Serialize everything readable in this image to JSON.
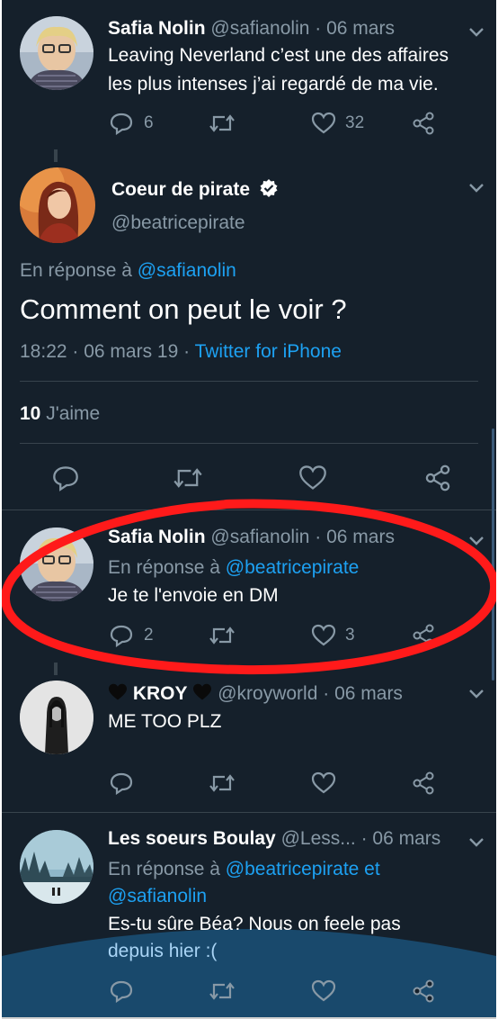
{
  "tweets": [
    {
      "author": "Safia Nolin",
      "handle": "@safianolin",
      "date": "· 06 mars",
      "text_lines": [
        "Leaving Neverland c’est une des affaires",
        "les plus intenses j’ai regardé de ma vie."
      ],
      "replies": "6",
      "likes": "32"
    },
    {
      "author": "Coeur de pirate",
      "handle": "@beatricepirate",
      "reply_prefix": "En réponse à",
      "reply_to": "@safianolin",
      "text": "Comment on peut le voir ?",
      "timestamp": "18:22 · 06 mars 19 ·",
      "source": "Twitter for iPhone",
      "like_count": "10",
      "like_label": "J'aime"
    },
    {
      "author": "Safia Nolin",
      "handle": "@safianolin",
      "date": "· 06 mars",
      "reply_prefix": "En réponse à",
      "reply_to": "@beatricepirate",
      "text": "Je te l'envoie en DM",
      "replies": "2",
      "likes": "3"
    },
    {
      "author": "KROY",
      "handle": "@kroyworld",
      "date": "· 06 mars",
      "text": "ME TOO PLZ"
    },
    {
      "author": "Les soeurs Boulay",
      "handle": "@Less...",
      "date": "· 06 mars",
      "reply_prefix": "En réponse à",
      "reply_to_line1": "@beatricepirate et",
      "reply_to_line2": "@safianolin",
      "text_line1": "Es-tu sûre Béa? Nous on feele pas",
      "text_line2": "depuis hier :("
    }
  ],
  "colors": {
    "background": "#15202b",
    "text": "#ffffff",
    "muted": "#8899a6",
    "link": "#1da1f2",
    "annotation": "#ff1a1a"
  },
  "icons": [
    "chevron-down-icon",
    "verified-badge-icon",
    "reply-icon",
    "retweet-icon",
    "like-icon",
    "share-icon",
    "heart-emoji-icon"
  ]
}
